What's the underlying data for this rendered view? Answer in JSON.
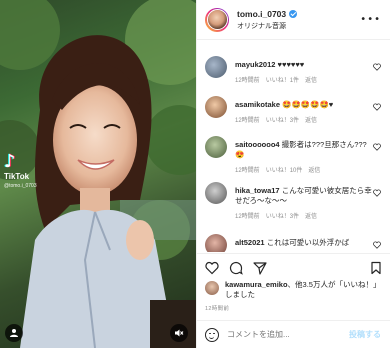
{
  "video": {
    "tiktok_logo": "♪",
    "tiktok_brand": "TikTok",
    "tiktok_handle": "@tomo.i_0703",
    "profile_icon": "user-icon",
    "mute_icon": "speaker-muted-icon"
  },
  "header": {
    "username": "tomo.i_0703",
    "subtitle": "オリジナル音源",
    "more": "•••"
  },
  "comments": [
    {
      "user": "mayuk2012",
      "text": " ♥♥♥♥♥♥",
      "time": "12時間前",
      "likes": "いいね！1件",
      "reply": "返信"
    },
    {
      "user": "asamikotake",
      "text": " 🤩🤩🤩🤩🤩♥",
      "time": "12時間前",
      "likes": "いいね！3件",
      "reply": "返信"
    },
    {
      "user": "saitoooooo4",
      "text": " 撮影者は???旦那さん???😍",
      "time": "12時間前",
      "likes": "いいね！10件",
      "reply": "返信"
    },
    {
      "user": "hika_towa17",
      "text": " こんな可愛い彼女居たら幸せだろ〜な〜〜",
      "time": "12時間前",
      "likes": "いいね！3件",
      "reply": "返信"
    },
    {
      "user": "alt52021",
      "text": " これは可愛い以外浮かば",
      "time": "",
      "likes": "",
      "reply": ""
    }
  ],
  "likes": {
    "user": "kawamura_emiko",
    "text": "、他3.5万人が「いいね！」しました"
  },
  "time": "12時間前",
  "comment_bar": {
    "placeholder": "コメントを追加...",
    "post": "投稿する"
  },
  "colors": {
    "accent": "#3897f0",
    "post_disabled": "#b2dffc",
    "meta": "#8e8e8e",
    "text": "#262626"
  }
}
